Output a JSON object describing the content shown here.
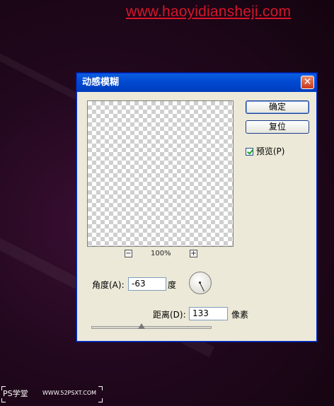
{
  "watermark": {
    "top_url": "www.haoyidiansheji.com",
    "bottom_logo": "PS学堂",
    "bottom_url": "WWW.52PSXT.COM"
  },
  "dialog": {
    "title": "动感模糊",
    "close_label": "✕",
    "ok_label": "确定",
    "reset_label": "复位",
    "preview_label": "预览(P)",
    "preview_checked": true,
    "zoom": {
      "minus_label": "−",
      "plus_label": "+",
      "level": "100%"
    },
    "angle": {
      "label": "角度(A):",
      "value": "-63",
      "unit": "度"
    },
    "distance": {
      "label": "距离(D):",
      "value": "133",
      "unit": "像素",
      "slider_fraction": 0.42
    }
  },
  "colors": {
    "accent_title": "#0049d1",
    "close": "#c9391a",
    "watermark_red": "#d8152a"
  }
}
